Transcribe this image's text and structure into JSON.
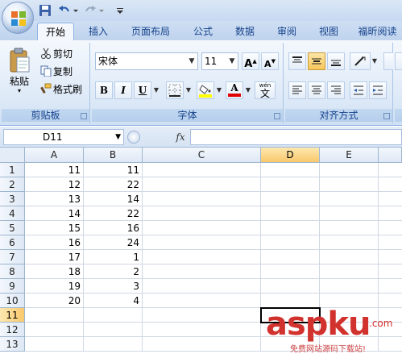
{
  "ribbon_tabs": [
    "开始",
    "插入",
    "页面布局",
    "公式",
    "数据",
    "审阅",
    "视图",
    "福昕阅读"
  ],
  "clipboard": {
    "paste_label": "粘贴",
    "cut_label": "剪切",
    "copy_label": "复制",
    "format_painter_label": "格式刷",
    "group_label": "剪贴板"
  },
  "font": {
    "name": "宋体",
    "size": "11",
    "bold_label": "B",
    "italic_label": "I",
    "underline_label": "U",
    "font_color_label": "A",
    "phonetic_label": "wén",
    "phonetic_char": "文",
    "group_label": "字体",
    "grow_label": "A",
    "shrink_label": "A"
  },
  "alignment": {
    "group_label": "对齐方式"
  },
  "formula_bar": {
    "name_box": "D11",
    "fx_label": "fx",
    "formula": ""
  },
  "columns": [
    "A",
    "B",
    "C",
    "D",
    "E"
  ],
  "selected_column": "D",
  "rows": [
    "1",
    "2",
    "3",
    "4",
    "5",
    "6",
    "7",
    "8",
    "9",
    "10",
    "11",
    "12",
    "13"
  ],
  "selected_row": "11",
  "cells": {
    "A": [
      "11",
      "12",
      "13",
      "14",
      "15",
      "16",
      "17",
      "18",
      "19",
      "20",
      "",
      "",
      ""
    ],
    "B": [
      "11",
      "22",
      "14",
      "22",
      "16",
      "24",
      "1",
      "2",
      "3",
      "4",
      "",
      "",
      ""
    ]
  },
  "watermark": {
    "main": "aspku",
    "sub": "免费网站源码下载站!",
    "domain": ".com"
  },
  "colors": {
    "accent": "#15428b",
    "selected_header": "#f9c86b",
    "watermark": "#d2322d"
  }
}
